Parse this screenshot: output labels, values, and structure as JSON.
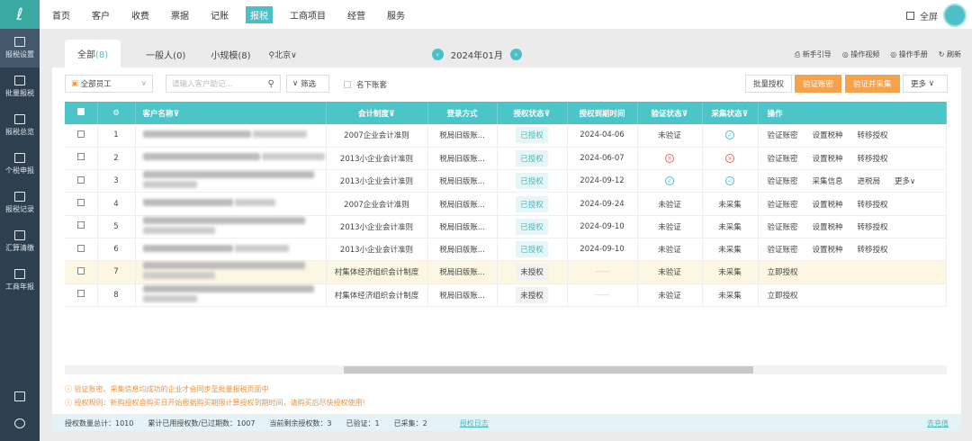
{
  "sidebar": {
    "items": [
      "报税设置",
      "批量报税",
      "报税总览",
      "个税申报",
      "报税记录",
      "汇算清缴",
      "工商年报"
    ]
  },
  "nav": {
    "items": [
      "首页",
      "客户",
      "收费",
      "票据",
      "记账",
      "报税",
      "工商项目",
      "经营",
      "服务"
    ],
    "active": 5,
    "fullscreen": "全屏"
  },
  "tabs": [
    {
      "label": "全部",
      "count": "(8)"
    },
    {
      "label": "一般人",
      "count": "(0)"
    },
    {
      "label": "小规模",
      "count": "(8)"
    }
  ],
  "region": "北京",
  "period": "2024年01月",
  "help_links": [
    "新手引导",
    "操作视频",
    "操作手册",
    "刷新"
  ],
  "toolbar": {
    "staff": "全部员工",
    "search_placeholder": "请输入客户助记...",
    "filter": "筛选",
    "my_accounts": "名下账套",
    "batch_auth": "批量授权",
    "verify": "验证账密",
    "verify_collect": "验证并采集",
    "more": "更多"
  },
  "table": {
    "headers": [
      "客户名称",
      "会计制度",
      "登录方式",
      "授权状态",
      "授权到期时间",
      "验证状态",
      "采集状态",
      "操作"
    ],
    "rows": [
      {
        "no": "1",
        "std": "2007企业会计准则",
        "login": "税局旧版账...",
        "auth": "已授权",
        "exp": "2024-04-06",
        "verify": "未验证",
        "collect": "ok",
        "ops": [
          "验证账密",
          "设置税种",
          "转移授权"
        ]
      },
      {
        "no": "2",
        "std": "2013小企业会计准则",
        "login": "税局旧版账...",
        "auth": "已授权",
        "exp": "2024-06-07",
        "verify": "bad",
        "collect": "bad",
        "ops": [
          "验证账密",
          "设置税种",
          "转移授权"
        ]
      },
      {
        "no": "3",
        "std": "2013小企业会计准则",
        "login": "税局旧版账...",
        "auth": "已授权",
        "exp": "2024-09-12",
        "verify": "ok",
        "collect": "ok",
        "ops": [
          "验证账密",
          "采集信息",
          "进税局",
          "更多∨"
        ]
      },
      {
        "no": "4",
        "std": "2007企业会计准则",
        "login": "税局旧版账...",
        "auth": "已授权",
        "exp": "2024-09-24",
        "verify": "未验证",
        "collect": "未采集",
        "ops": [
          "验证账密",
          "设置税种",
          "转移授权"
        ]
      },
      {
        "no": "5",
        "std": "2013小企业会计准则",
        "login": "税局旧版账...",
        "auth": "已授权",
        "exp": "2024-09-10",
        "verify": "未验证",
        "collect": "未采集",
        "ops": [
          "验证账密",
          "设置税种",
          "转移授权"
        ]
      },
      {
        "no": "6",
        "std": "2013小企业会计准则",
        "login": "税局旧版账...",
        "auth": "已授权",
        "exp": "2024-09-10",
        "verify": "未验证",
        "collect": "未采集",
        "ops": [
          "验证账密",
          "设置税种",
          "转移授权"
        ]
      },
      {
        "no": "7",
        "std": "村集体经济组织会计制度",
        "login": "税局旧版账...",
        "auth": "未授权",
        "exp": "——",
        "verify": "未验证",
        "collect": "未采集",
        "ops": [
          "立即授权"
        ]
      },
      {
        "no": "8",
        "std": "村集体经济组织会计制度",
        "login": "税局旧版账...",
        "auth": "未授权",
        "exp": "——",
        "verify": "未验证",
        "collect": "未采集",
        "ops": [
          "立即授权"
        ]
      }
    ]
  },
  "notes": [
    "验证账密、采集信息均成功的企业才会同步至批量报税页面中",
    "授权规则：新购授权自购买日开始根据购买期限计算授权到期时间，请购买后尽快授权使用!"
  ],
  "footer": {
    "total": "授权数量总计：1010",
    "used": "累计已用授权数/已过期数：1007",
    "remain": "当前剩余授权数：3",
    "verified": "已验证：1",
    "collected": "已采集：2",
    "log": "授权日志",
    "recharge": "去充值"
  }
}
